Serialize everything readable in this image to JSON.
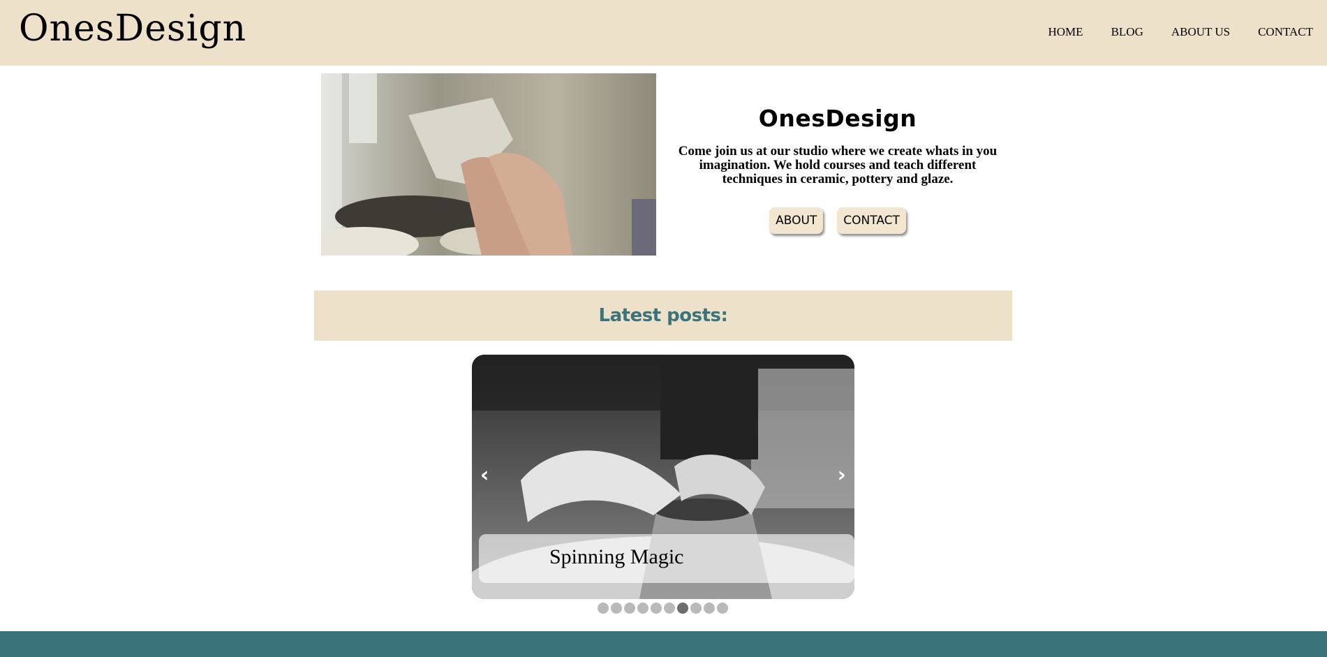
{
  "header": {
    "logo": "OnesDesign",
    "nav": [
      "HOME",
      "BLOG",
      "ABOUT US",
      "CONTACT"
    ]
  },
  "hero": {
    "title": "OnesDesign",
    "description": "Come join us at our studio where we create whats in you imagination. We hold courses and teach different techniques in ceramic, pottery and glaze.",
    "buttons": {
      "about": "ABOUT",
      "contact": "CONTACT"
    }
  },
  "latest": {
    "heading": "Latest posts:"
  },
  "slider": {
    "caption": "Spinning Magic",
    "prev_arrow": "‹",
    "next_arrow": "›",
    "dot_count": 10,
    "active_dot": 6
  },
  "colors": {
    "beige": "#ede1c9",
    "teal": "#3a737a",
    "button_bg": "#f2e6cf"
  }
}
